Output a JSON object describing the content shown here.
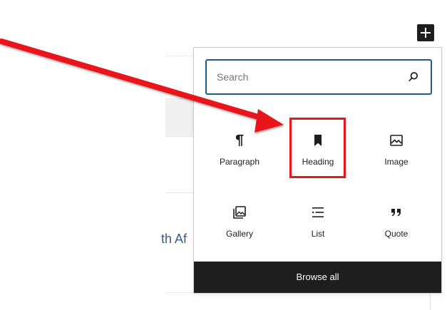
{
  "background": {
    "partial_text": "th Af"
  },
  "toolbar": {
    "add_block_icon": "plus-icon"
  },
  "inserter": {
    "search": {
      "placeholder": "Search",
      "value": "",
      "icon": "search-icon"
    },
    "blocks": [
      {
        "label": "Paragraph",
        "icon": "paragraph-icon"
      },
      {
        "label": "Heading",
        "icon": "bookmark-icon"
      },
      {
        "label": "Image",
        "icon": "image-icon"
      },
      {
        "label": "Gallery",
        "icon": "gallery-icon"
      },
      {
        "label": "List",
        "icon": "list-icon"
      },
      {
        "label": "Quote",
        "icon": "quote-icon"
      }
    ],
    "browse_all_label": "Browse all"
  },
  "annotation": {
    "highlight_color": "#e8161a",
    "arrow_color": "#e8161a"
  }
}
